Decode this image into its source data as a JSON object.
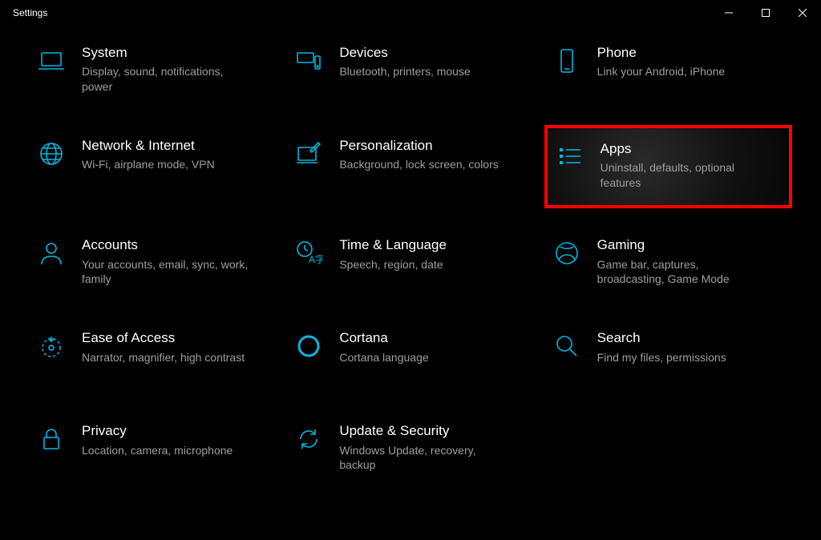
{
  "window": {
    "title": "Settings"
  },
  "accent": "#00b7e0",
  "highlight_border": "#ff0000",
  "categories": [
    {
      "id": "system",
      "title": "System",
      "sub": "Display, sound, notifications, power"
    },
    {
      "id": "devices",
      "title": "Devices",
      "sub": "Bluetooth, printers, mouse"
    },
    {
      "id": "phone",
      "title": "Phone",
      "sub": "Link your Android, iPhone"
    },
    {
      "id": "network",
      "title": "Network & Internet",
      "sub": "Wi-Fi, airplane mode, VPN"
    },
    {
      "id": "personalization",
      "title": "Personalization",
      "sub": "Background, lock screen, colors"
    },
    {
      "id": "apps",
      "title": "Apps",
      "sub": "Uninstall, defaults, optional features",
      "highlighted": true
    },
    {
      "id": "accounts",
      "title": "Accounts",
      "sub": "Your accounts, email, sync, work, family"
    },
    {
      "id": "time-language",
      "title": "Time & Language",
      "sub": "Speech, region, date"
    },
    {
      "id": "gaming",
      "title": "Gaming",
      "sub": "Game bar, captures, broadcasting, Game Mode"
    },
    {
      "id": "ease-of-access",
      "title": "Ease of Access",
      "sub": "Narrator, magnifier, high contrast"
    },
    {
      "id": "cortana",
      "title": "Cortana",
      "sub": "Cortana language"
    },
    {
      "id": "search",
      "title": "Search",
      "sub": "Find my files, permissions"
    },
    {
      "id": "privacy",
      "title": "Privacy",
      "sub": "Location, camera, microphone"
    },
    {
      "id": "update-security",
      "title": "Update & Security",
      "sub": "Windows Update, recovery, backup"
    }
  ]
}
